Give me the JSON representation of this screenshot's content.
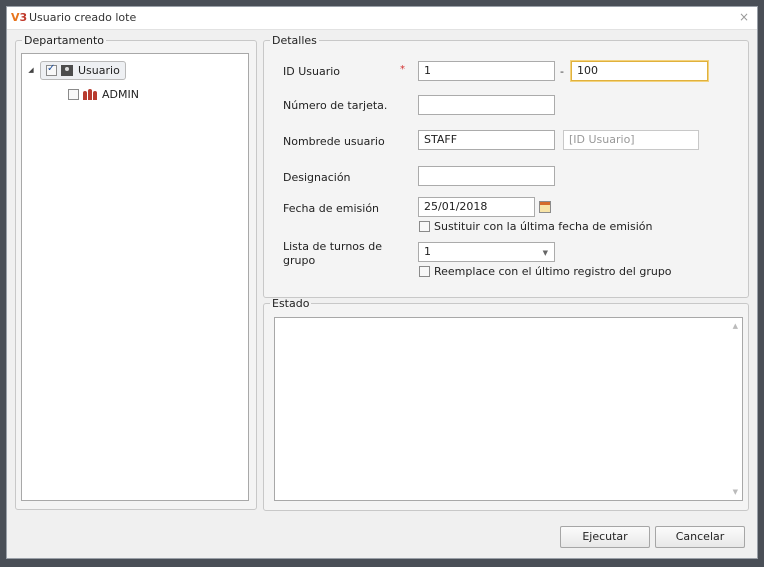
{
  "window": {
    "title": "Usuario creado lote",
    "close": "×"
  },
  "departamento": {
    "legend": "Departamento",
    "tree": [
      {
        "label": "Usuario",
        "checked": true
      },
      {
        "label": "ADMIN",
        "checked": false
      }
    ]
  },
  "detalles": {
    "legend": "Detalles",
    "id_usuario": {
      "label": "ID Usuario",
      "required": "*",
      "from": "1",
      "separator": "-",
      "to": "100"
    },
    "numero_tarjeta": {
      "label": "Número de tarjeta.",
      "value": ""
    },
    "nombre_usuario": {
      "label": "Nombrede usuario",
      "value": "STAFF",
      "suffix_placeholder": "[ID Usuario]"
    },
    "designacion": {
      "label": "Designación",
      "value": ""
    },
    "fecha_emision": {
      "label": "Fecha de emisión",
      "value": "25/01/2018",
      "checkbox": "Sustituir con la última fecha de emisión"
    },
    "lista_turnos": {
      "label_line1": "Lista de turnos de",
      "label_line2": "grupo",
      "value": "1",
      "checkbox": "Reemplace con el último registro del grupo"
    }
  },
  "estado": {
    "legend": "Estado"
  },
  "buttons": {
    "ejecutar": "Ejecutar",
    "cancelar": "Cancelar"
  }
}
